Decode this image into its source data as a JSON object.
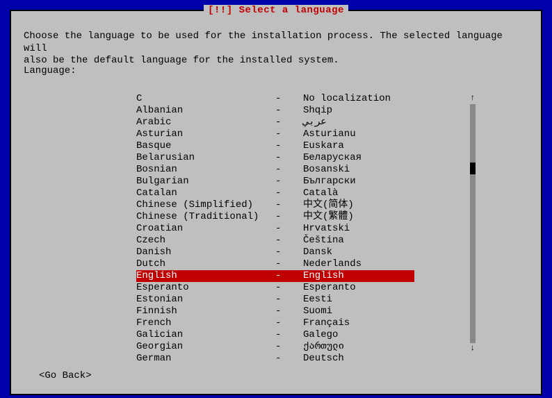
{
  "title": "[!!] Select a language",
  "intro_line1": "Choose the language to be used for the installation process. The selected language will",
  "intro_line2": "also be the default language for the installed system.",
  "label": "Language:",
  "languages": [
    {
      "name": "C",
      "native": "No localization",
      "selected": false
    },
    {
      "name": "Albanian",
      "native": "Shqip",
      "selected": false
    },
    {
      "name": "Arabic",
      "native": "عربي",
      "selected": false
    },
    {
      "name": "Asturian",
      "native": "Asturianu",
      "selected": false
    },
    {
      "name": "Basque",
      "native": "Euskara",
      "selected": false
    },
    {
      "name": "Belarusian",
      "native": "Беларуская",
      "selected": false
    },
    {
      "name": "Bosnian",
      "native": "Bosanski",
      "selected": false
    },
    {
      "name": "Bulgarian",
      "native": "Български",
      "selected": false
    },
    {
      "name": "Catalan",
      "native": "Català",
      "selected": false
    },
    {
      "name": "Chinese (Simplified)",
      "native": "中文(简体)",
      "selected": false
    },
    {
      "name": "Chinese (Traditional)",
      "native": "中文(繁體)",
      "selected": false
    },
    {
      "name": "Croatian",
      "native": "Hrvatski",
      "selected": false
    },
    {
      "name": "Czech",
      "native": "Čeština",
      "selected": false
    },
    {
      "name": "Danish",
      "native": "Dansk",
      "selected": false
    },
    {
      "name": "Dutch",
      "native": "Nederlands",
      "selected": false
    },
    {
      "name": "English",
      "native": "English",
      "selected": true
    },
    {
      "name": "Esperanto",
      "native": "Esperanto",
      "selected": false
    },
    {
      "name": "Estonian",
      "native": "Eesti",
      "selected": false
    },
    {
      "name": "Finnish",
      "native": "Suomi",
      "selected": false
    },
    {
      "name": "French",
      "native": "Français",
      "selected": false
    },
    {
      "name": "Galician",
      "native": "Galego",
      "selected": false
    },
    {
      "name": "Georgian",
      "native": "ქართული",
      "selected": false
    },
    {
      "name": "German",
      "native": "Deutsch",
      "selected": false
    }
  ],
  "separator": "-",
  "go_back": "<Go Back>",
  "scroll_up": "↑",
  "scroll_down": "↓"
}
